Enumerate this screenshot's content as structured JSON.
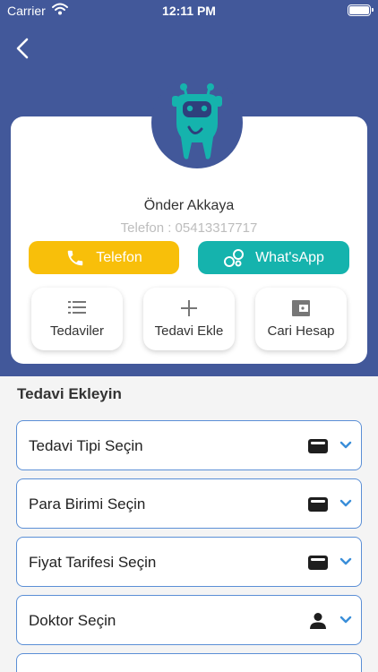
{
  "status_bar": {
    "carrier": "Carrier",
    "time": "12:11 PM"
  },
  "profile": {
    "name": "Önder Akkaya",
    "phone": "Telefon : 05413317717"
  },
  "actions": {
    "phone_label": "Telefon",
    "whatsapp_label": "What'sApp"
  },
  "tiles": {
    "treatments": "Tedaviler",
    "add_treatment": "Tedavi Ekle",
    "account": "Cari Hesap"
  },
  "form": {
    "title": "Tedavi Ekleyin",
    "fields": [
      {
        "label": "Tedavi Tipi Seçin",
        "icon": "wallet-icon"
      },
      {
        "label": "Para Birimi Seçin",
        "icon": "wallet-icon"
      },
      {
        "label": "Fiyat Tarifesi Seçin",
        "icon": "wallet-icon"
      },
      {
        "label": "Doktor Seçin",
        "icon": "person-icon"
      }
    ]
  },
  "colors": {
    "header": "#42589a",
    "phone_button": "#f8bf0a",
    "whatsapp_button": "#15b3ad",
    "field_border": "#5b8fd6",
    "mascot": "#15b3ad"
  }
}
